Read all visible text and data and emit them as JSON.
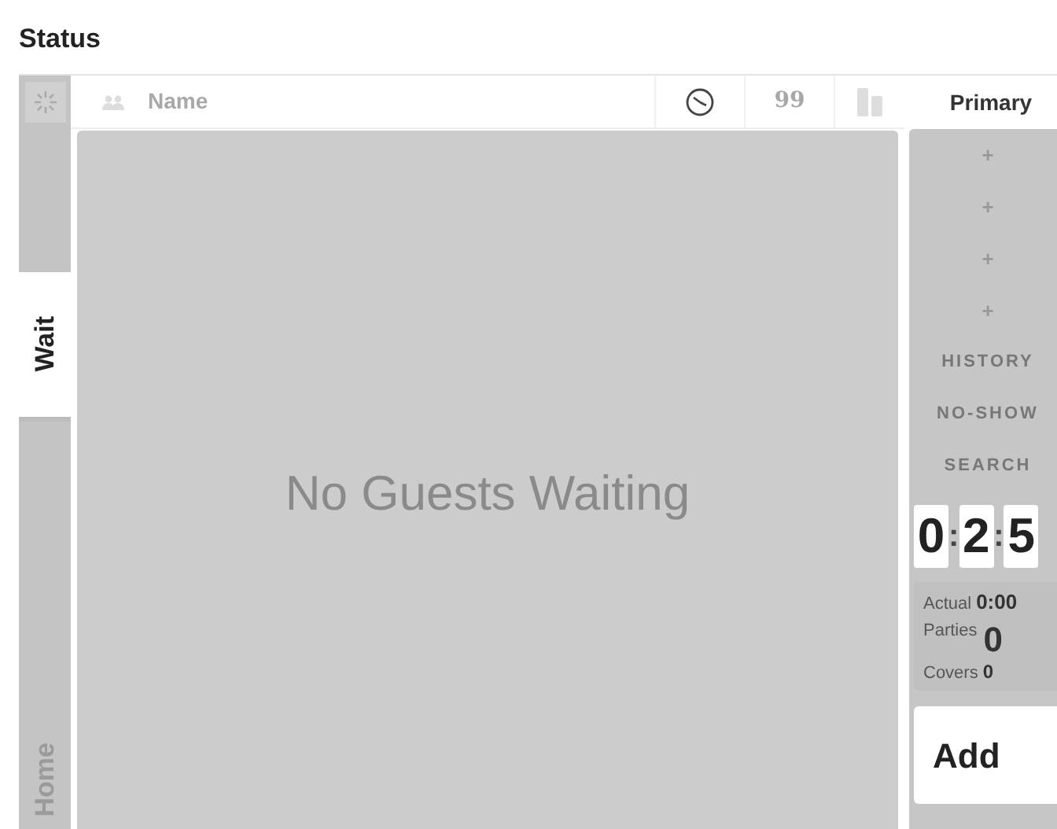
{
  "title": "Status",
  "tabs": [
    {
      "label": "Wait",
      "selected": true
    },
    {
      "label": "Home",
      "selected": false
    }
  ],
  "header": {
    "name_column": "Name",
    "quote_mark": "99"
  },
  "empty_message": "No Guests Waiting",
  "side_panel": {
    "title": "Primary",
    "plus_buttons": [
      "+",
      "+",
      "+",
      "+"
    ],
    "actions": [
      "HISTORY",
      "NO-SHOW",
      "SEARCH"
    ],
    "timer": {
      "digits": [
        "0",
        "2",
        "5"
      ],
      "separator": ":"
    },
    "stats": {
      "actual_label": "Actual",
      "actual": "0:00",
      "parties_label": "Parties",
      "parties": "0",
      "covers_label": "Covers",
      "covers": "0"
    },
    "add_button": "Add"
  }
}
